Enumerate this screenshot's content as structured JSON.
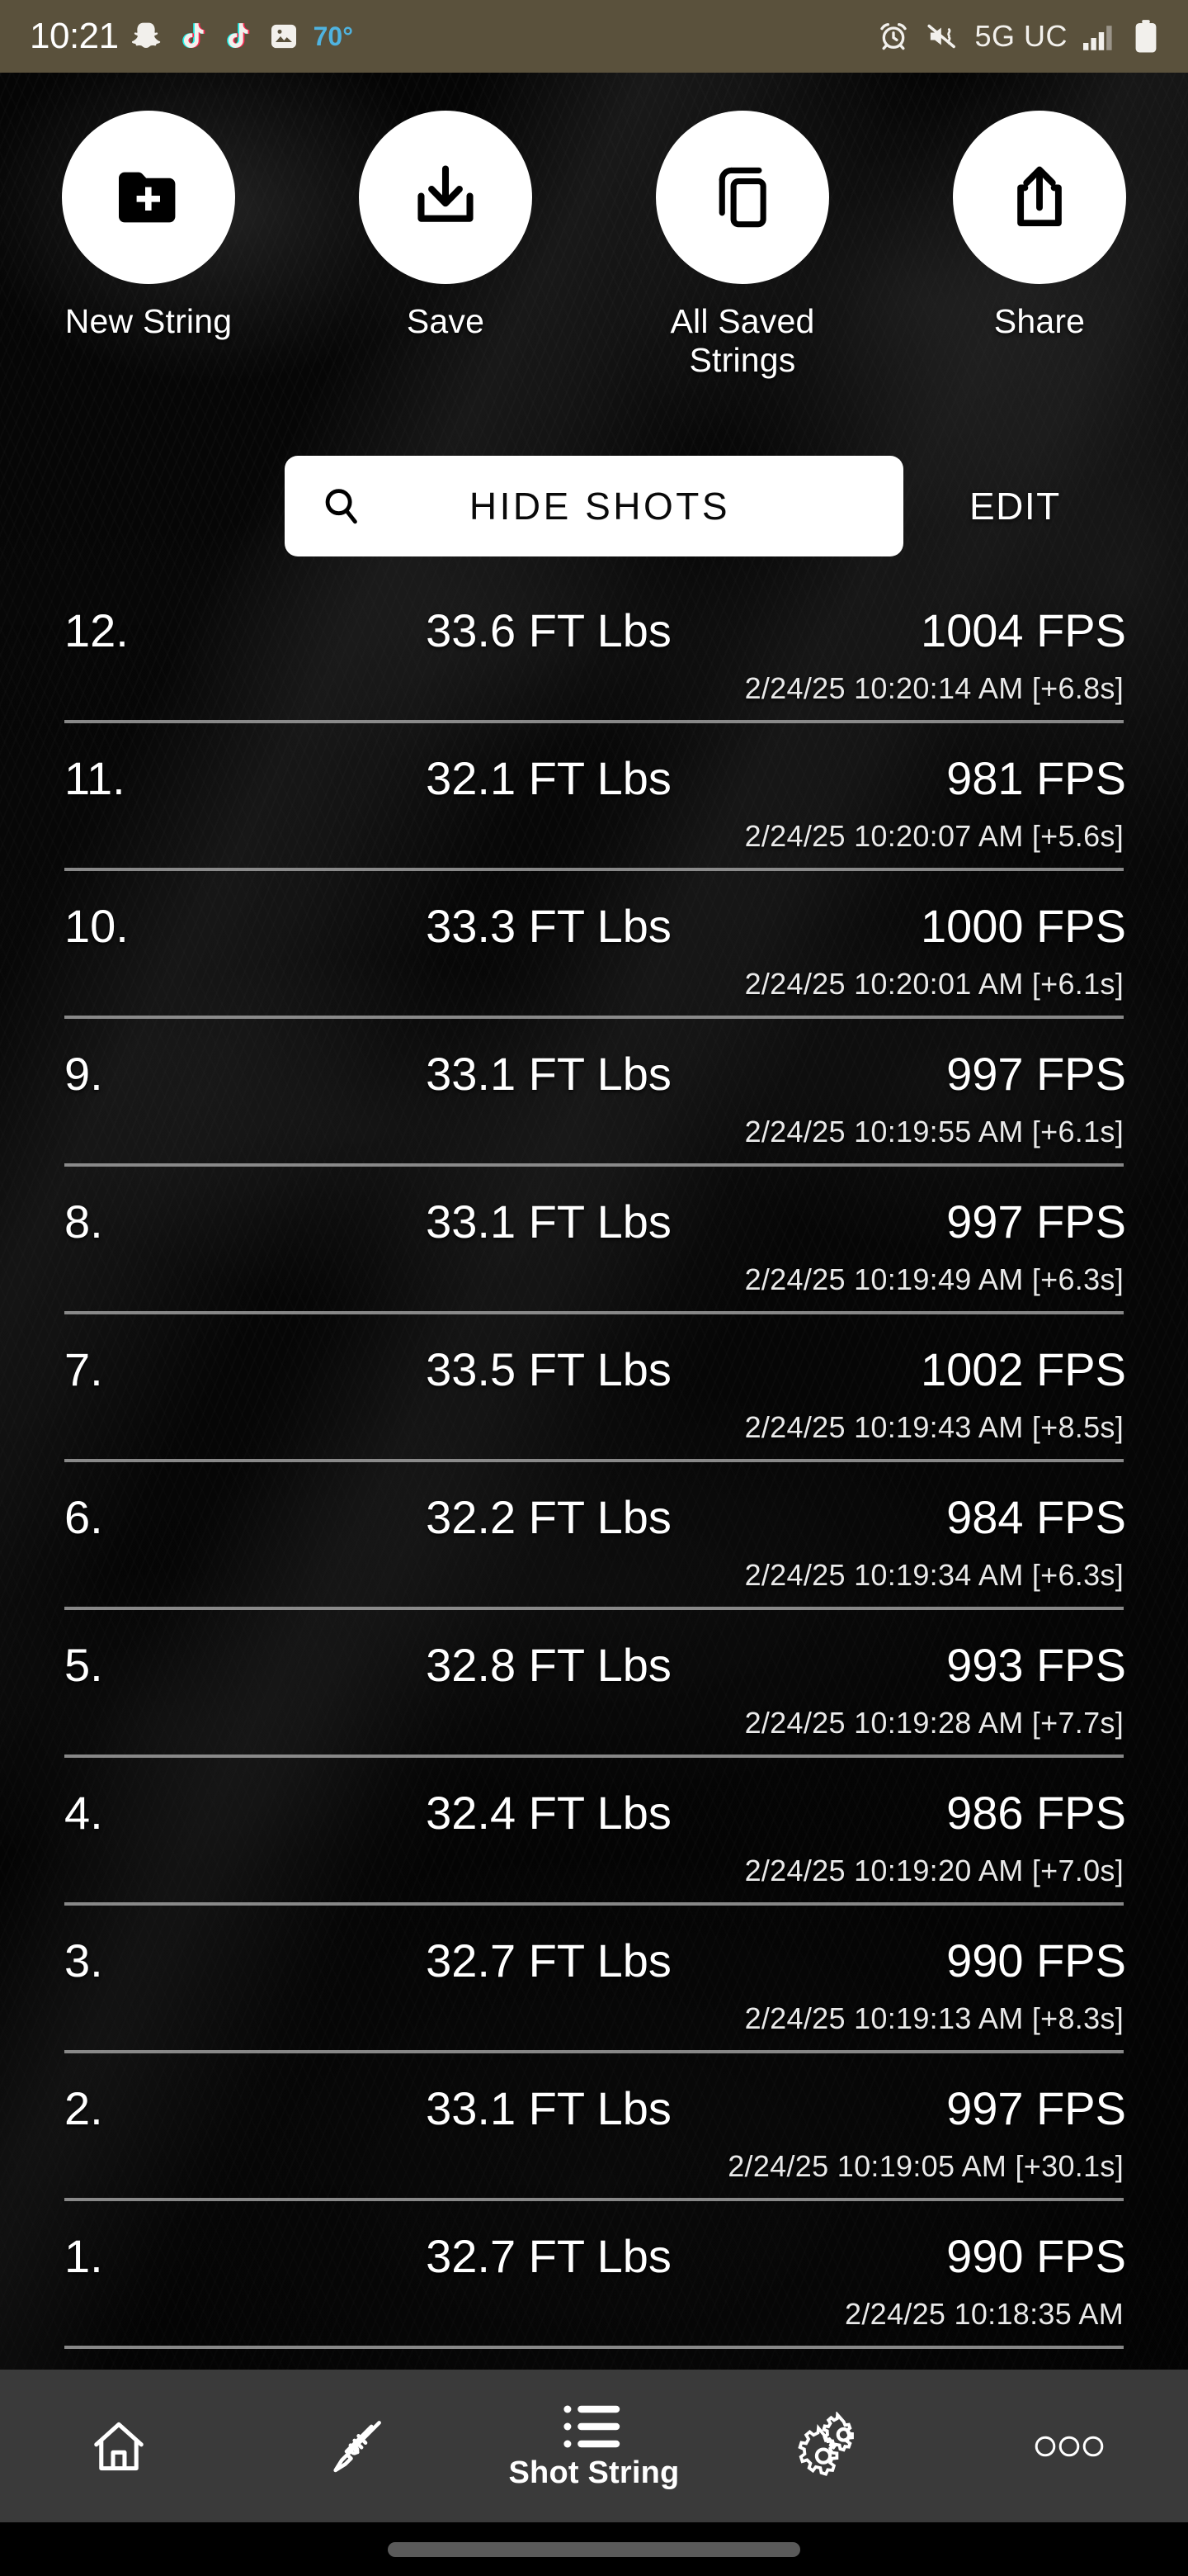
{
  "status_bar": {
    "time": "10:21",
    "temperature": "70°",
    "network": "5G UC",
    "icons": [
      "snapchat-icon",
      "tiktok-icon",
      "tiktok-icon",
      "photos-icon",
      "alarm-icon",
      "vibrate-icon",
      "signal-icon",
      "battery-icon"
    ],
    "background_color": "#5a513c"
  },
  "actions": [
    {
      "label": "New String",
      "icon": "folder-plus-icon"
    },
    {
      "label": "Save",
      "icon": "download-icon"
    },
    {
      "label": "All Saved Strings",
      "icon": "copy-icon"
    },
    {
      "label": "Share",
      "icon": "share-upload-icon"
    }
  ],
  "search": {
    "button_label": "HIDE SHOTS",
    "icon": "search-icon",
    "edit_label": "EDIT"
  },
  "shots": [
    {
      "index": "12.",
      "energy": "33.6 FT Lbs",
      "speed": "1004 FPS",
      "timestamp": "2/24/25 10:20:14 AM [+6.8s]"
    },
    {
      "index": "11.",
      "energy": "32.1 FT Lbs",
      "speed": "981 FPS",
      "timestamp": "2/24/25 10:20:07 AM [+5.6s]"
    },
    {
      "index": "10.",
      "energy": "33.3 FT Lbs",
      "speed": "1000 FPS",
      "timestamp": "2/24/25 10:20:01 AM [+6.1s]"
    },
    {
      "index": "9.",
      "energy": "33.1 FT Lbs",
      "speed": "997 FPS",
      "timestamp": "2/24/25 10:19:55 AM [+6.1s]"
    },
    {
      "index": "8.",
      "energy": "33.1 FT Lbs",
      "speed": "997 FPS",
      "timestamp": "2/24/25 10:19:49 AM [+6.3s]"
    },
    {
      "index": "7.",
      "energy": "33.5 FT Lbs",
      "speed": "1002 FPS",
      "timestamp": "2/24/25 10:19:43 AM [+8.5s]"
    },
    {
      "index": "6.",
      "energy": "32.2 FT Lbs",
      "speed": "984 FPS",
      "timestamp": "2/24/25 10:19:34 AM [+6.3s]"
    },
    {
      "index": "5.",
      "energy": "32.8 FT Lbs",
      "speed": "993 FPS",
      "timestamp": "2/24/25 10:19:28 AM [+7.7s]"
    },
    {
      "index": "4.",
      "energy": "32.4 FT Lbs",
      "speed": "986 FPS",
      "timestamp": "2/24/25 10:19:20 AM [+7.0s]"
    },
    {
      "index": "3.",
      "energy": "32.7 FT Lbs",
      "speed": "990 FPS",
      "timestamp": "2/24/25 10:19:13 AM [+8.3s]"
    },
    {
      "index": "2.",
      "energy": "33.1 FT Lbs",
      "speed": "997 FPS",
      "timestamp": "2/24/25 10:19:05 AM [+30.1s]"
    },
    {
      "index": "1.",
      "energy": "32.7 FT Lbs",
      "speed": "990 FPS",
      "timestamp": "2/24/25 10:18:35 AM"
    }
  ],
  "bottom_nav": {
    "items": [
      {
        "label": "",
        "icon": "home-icon",
        "active": false
      },
      {
        "label": "",
        "icon": "rifle-icon",
        "active": false
      },
      {
        "label": "Shot String",
        "icon": "list-icon",
        "active": true
      },
      {
        "label": "",
        "icon": "gears-icon",
        "active": false
      },
      {
        "label": "",
        "icon": "more-dots-icon",
        "active": false
      }
    ],
    "background_color": "#3a3a3a"
  }
}
